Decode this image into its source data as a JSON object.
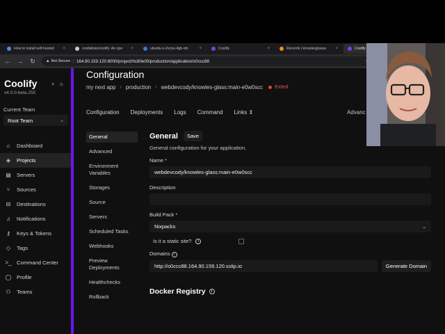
{
  "browser": {
    "tabs": [
      {
        "label": "How to install self-hosted",
        "favicon_color": "#4a90e2",
        "active": false
      },
      {
        "label": "coollabsio/coolify: An ope",
        "favicon_color": "#cccccc",
        "active": false
      },
      {
        "label": "ubuntu-s-2vcpu-4gb-sfo",
        "favicon_color": "#3b7bd8",
        "active": false
      },
      {
        "label": "Coolify",
        "favicon_color": "#7b3fe4",
        "active": false
      },
      {
        "label": "Records | knowlesglasse",
        "favicon_color": "#f28c28",
        "active": false
      },
      {
        "label": "Coolify",
        "favicon_color": "#7b3fe4",
        "active": true
      }
    ],
    "not_secure": "Not Secure",
    "url": "164.90.159.120:8000/project/hc80e00/production/application/o0ccc88"
  },
  "sidebar": {
    "brand": "Coolify",
    "version": "v4.0.0-beta.255",
    "current_team_label": "Current Team",
    "team": "Root Team",
    "items": [
      {
        "label": "Dashboard",
        "icon": "home-icon"
      },
      {
        "label": "Projects",
        "icon": "layers-icon"
      },
      {
        "label": "Servers",
        "icon": "server-icon"
      },
      {
        "label": "Sources",
        "icon": "branch-icon"
      },
      {
        "label": "Destinations",
        "icon": "destination-icon"
      },
      {
        "label": "Notifications",
        "icon": "bell-icon"
      },
      {
        "label": "Keys & Tokens",
        "icon": "key-icon"
      },
      {
        "label": "Tags",
        "icon": "tag-icon"
      },
      {
        "label": "Command Center",
        "icon": "terminal-icon"
      },
      {
        "label": "Profile",
        "icon": "user-icon"
      },
      {
        "label": "Teams",
        "icon": "users-icon"
      }
    ]
  },
  "main": {
    "title": "Configuration",
    "breadcrumb": [
      "my next app",
      "production",
      "webdevcody/knowles-glass:main-e0w0scc"
    ],
    "status": "Exited",
    "subnav": [
      "Configuration",
      "Deployments",
      "Logs",
      "Command",
      "Links"
    ],
    "subnav_right": "Advanc",
    "settings_menu": [
      "General",
      "Advanced",
      "Environment Variables",
      "Storages",
      "Source",
      "Servers",
      "Scheduled Tasks",
      "Webhooks",
      "Preview Deployments",
      "Healthchecks",
      "Rollback"
    ],
    "general": {
      "title": "General",
      "save": "Save",
      "description": "General configuration for your application.",
      "name_label": "Name",
      "name_value": "webdevcody/knowles-glass:main-e0w0scc",
      "description_label": "Description",
      "description_value": "",
      "build_pack_label": "Build Pack",
      "build_pack_value": "Nixpacks",
      "static_label": "Is it a static site?",
      "domains_label": "Domains",
      "domains_value": "http://o0ccc88.164.90.159.120.sslip.io",
      "generate_domain": "Generate Domain"
    },
    "docker_registry_title": "Docker Registry"
  },
  "colors": {
    "accent": "#6b16ed",
    "status_exited": "#e04040",
    "required_star": "#f0c020"
  }
}
